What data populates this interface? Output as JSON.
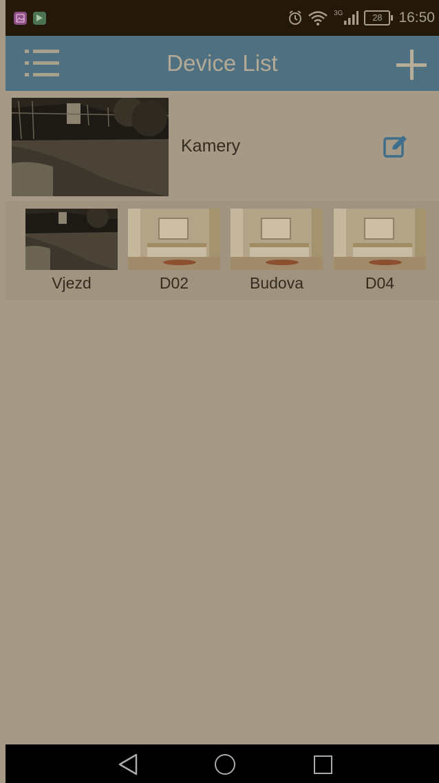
{
  "status_bar": {
    "time": "16:50",
    "battery": "28",
    "network": "3G",
    "icons": [
      "gallery-icon",
      "play-store-icon",
      "alarm-icon",
      "wifi-icon",
      "signal-icon",
      "battery-icon"
    ]
  },
  "app_bar": {
    "title": "Device List",
    "menu_icon": "menu-icon",
    "add_icon": "plus-icon"
  },
  "group": {
    "name": "Kamery",
    "edit_icon": "edit-icon"
  },
  "devices": [
    {
      "label": "Vjezd",
      "thumbnail": "night-driveway-camera"
    },
    {
      "label": "D02",
      "thumbnail": "bedroom-placeholder"
    },
    {
      "label": "Budova",
      "thumbnail": "bedroom-placeholder"
    },
    {
      "label": "D04",
      "thumbnail": "bedroom-placeholder"
    }
  ],
  "nav_bar": {
    "icons": [
      "back-icon",
      "home-icon",
      "recent-apps-icon"
    ]
  },
  "colors": {
    "background": "#a69a86",
    "app_bar": "#4f7080",
    "status_bar": "#24180a",
    "accent": "#3f6e8c"
  }
}
